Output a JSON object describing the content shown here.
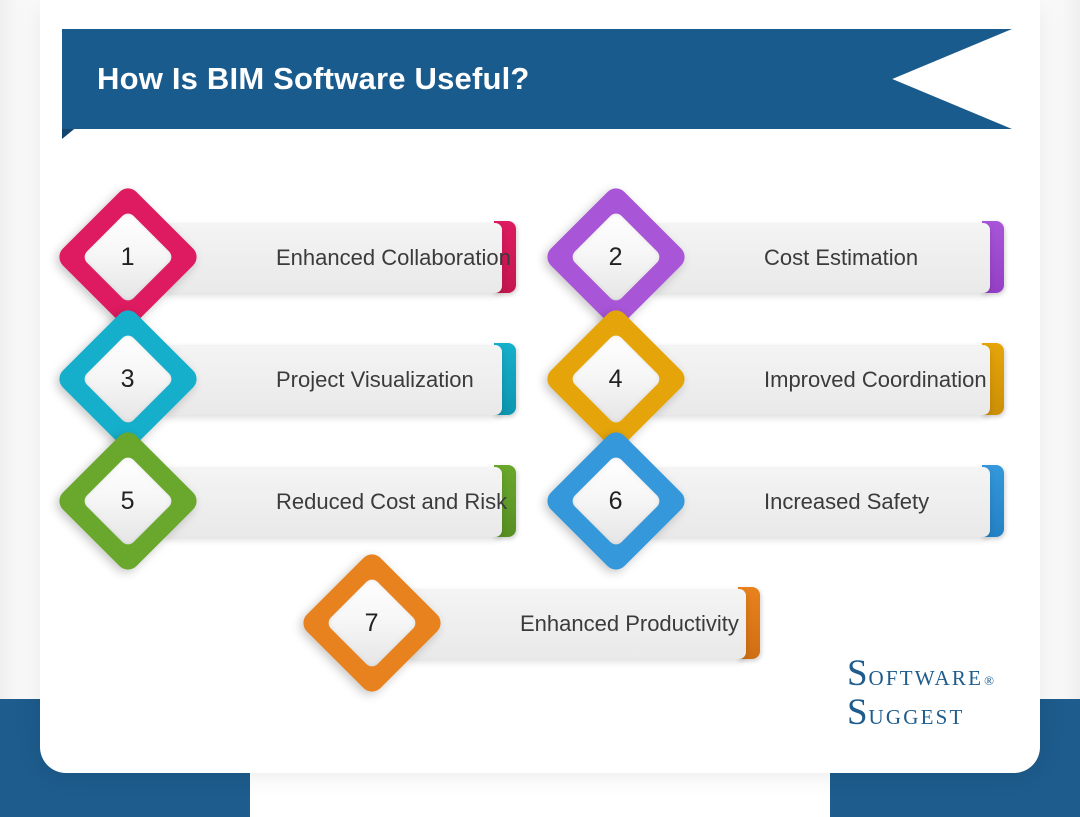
{
  "page": {
    "background_color": "#ffffff",
    "card_color": "#ffffff",
    "accent_blue": "#1a5b8d"
  },
  "header": {
    "title": "How Is BIM Software Useful?",
    "ribbon_color": "#1a5b8d",
    "fold_color": "#14466d",
    "title_color": "#ffffff"
  },
  "items": [
    {
      "number": "1",
      "label": "Enhanced Collaboration",
      "color": "#de1b60",
      "color_dark": "#c4164f",
      "column": "left"
    },
    {
      "number": "2",
      "label": "Cost Estimation",
      "color": "#a855d8",
      "color_dark": "#9440c6",
      "column": "right"
    },
    {
      "number": "3",
      "label": "Project Visualization",
      "color": "#16afcb",
      "color_dark": "#0e96b0",
      "column": "left"
    },
    {
      "number": "4",
      "label": "Improved Coordination",
      "color": "#e5a50a",
      "color_dark": "#cc8f06",
      "column": "right"
    },
    {
      "number": "5",
      "label": "Reduced Cost and Risk",
      "color": "#69a82c",
      "color_dark": "#588f23",
      "column": "left"
    },
    {
      "number": "6",
      "label": "Increased Safety",
      "color": "#3498db",
      "color_dark": "#2481c4",
      "column": "right"
    },
    {
      "number": "7",
      "label": "Enhanced Productivity",
      "color": "#e8821e",
      "color_dark": "#cf6e13",
      "column": "center"
    }
  ],
  "logo": {
    "line1_cap": "S",
    "line1_rest": "OFTWARE",
    "registered": "®",
    "line2_cap": "S",
    "line2_rest": "UGGEST",
    "color": "#1d5c8d"
  }
}
